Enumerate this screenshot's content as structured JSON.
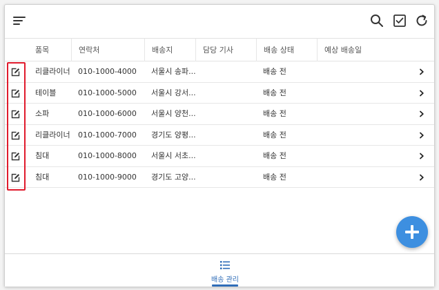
{
  "colors": {
    "accent": "#3d8fe0",
    "nav_active": "#2f6db8",
    "highlight": "#e0192b"
  },
  "toolbar": {
    "icons": [
      "sort-lines-icon",
      "search-icon",
      "checkbox-checked-icon",
      "refresh-icon"
    ]
  },
  "table": {
    "headers": [
      "품목",
      "연락처",
      "배송지",
      "담당 기사",
      "배송 상태",
      "예상 배송일"
    ],
    "rows": [
      {
        "item": "리클라이너",
        "contact": "010-1000-4000",
        "address": "서울시 송파...",
        "driver": "",
        "status": "배송 전",
        "eta": ""
      },
      {
        "item": "테이블",
        "contact": "010-1000-5000",
        "address": "서울시 강서...",
        "driver": "",
        "status": "배송 전",
        "eta": ""
      },
      {
        "item": "소파",
        "contact": "010-1000-6000",
        "address": "서울시 양천...",
        "driver": "",
        "status": "배송 전",
        "eta": ""
      },
      {
        "item": "리클라이너",
        "contact": "010-1000-7000",
        "address": "경기도 양평...",
        "driver": "",
        "status": "배송 전",
        "eta": ""
      },
      {
        "item": "침대",
        "contact": "010-1000-8000",
        "address": "서울시 서초...",
        "driver": "",
        "status": "배송 전",
        "eta": ""
      },
      {
        "item": "침대",
        "contact": "010-1000-9000",
        "address": "경기도 고양...",
        "driver": "",
        "status": "배송 전",
        "eta": ""
      }
    ]
  },
  "fab": {
    "icon": "plus-icon"
  },
  "bottom_nav": {
    "items": [
      {
        "label": "배송 관리",
        "icon": "list-icon",
        "active": true
      }
    ]
  }
}
